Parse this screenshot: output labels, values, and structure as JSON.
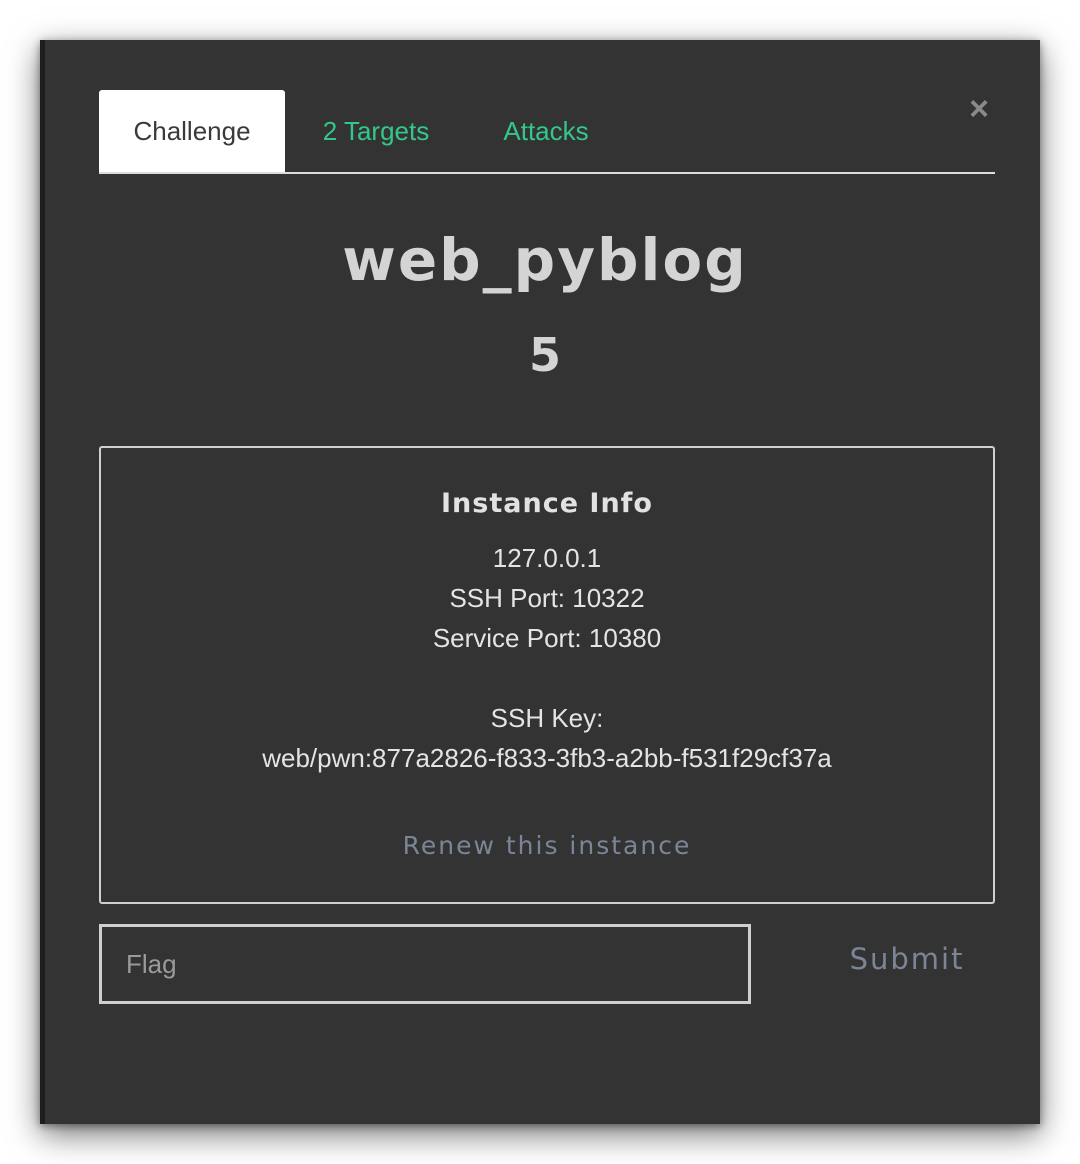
{
  "tabs": [
    {
      "label": "Challenge",
      "active": true
    },
    {
      "label": "2 Targets",
      "active": false
    },
    {
      "label": "Attacks",
      "active": false
    }
  ],
  "close_icon": "close-icon",
  "challenge": {
    "name": "web_pyblog",
    "points": "5"
  },
  "instance": {
    "heading": "Instance Info",
    "ip": "127.0.0.1",
    "ssh_port": "SSH Port: 10322",
    "service_port": "Service Port: 10380",
    "ssh_key_label": "SSH Key:",
    "ssh_key_value": "web/pwn:877a2826-f833-3fb3-a2bb-f531f29cf37a",
    "renew_label": "Renew this instance"
  },
  "flag_form": {
    "placeholder": "Flag",
    "value": "",
    "submit_label": "Submit"
  },
  "colors": {
    "modal_bg": "#333333",
    "accent_link": "#33c88a",
    "muted_link": "#7c8596",
    "text": "#e4e4e4"
  }
}
